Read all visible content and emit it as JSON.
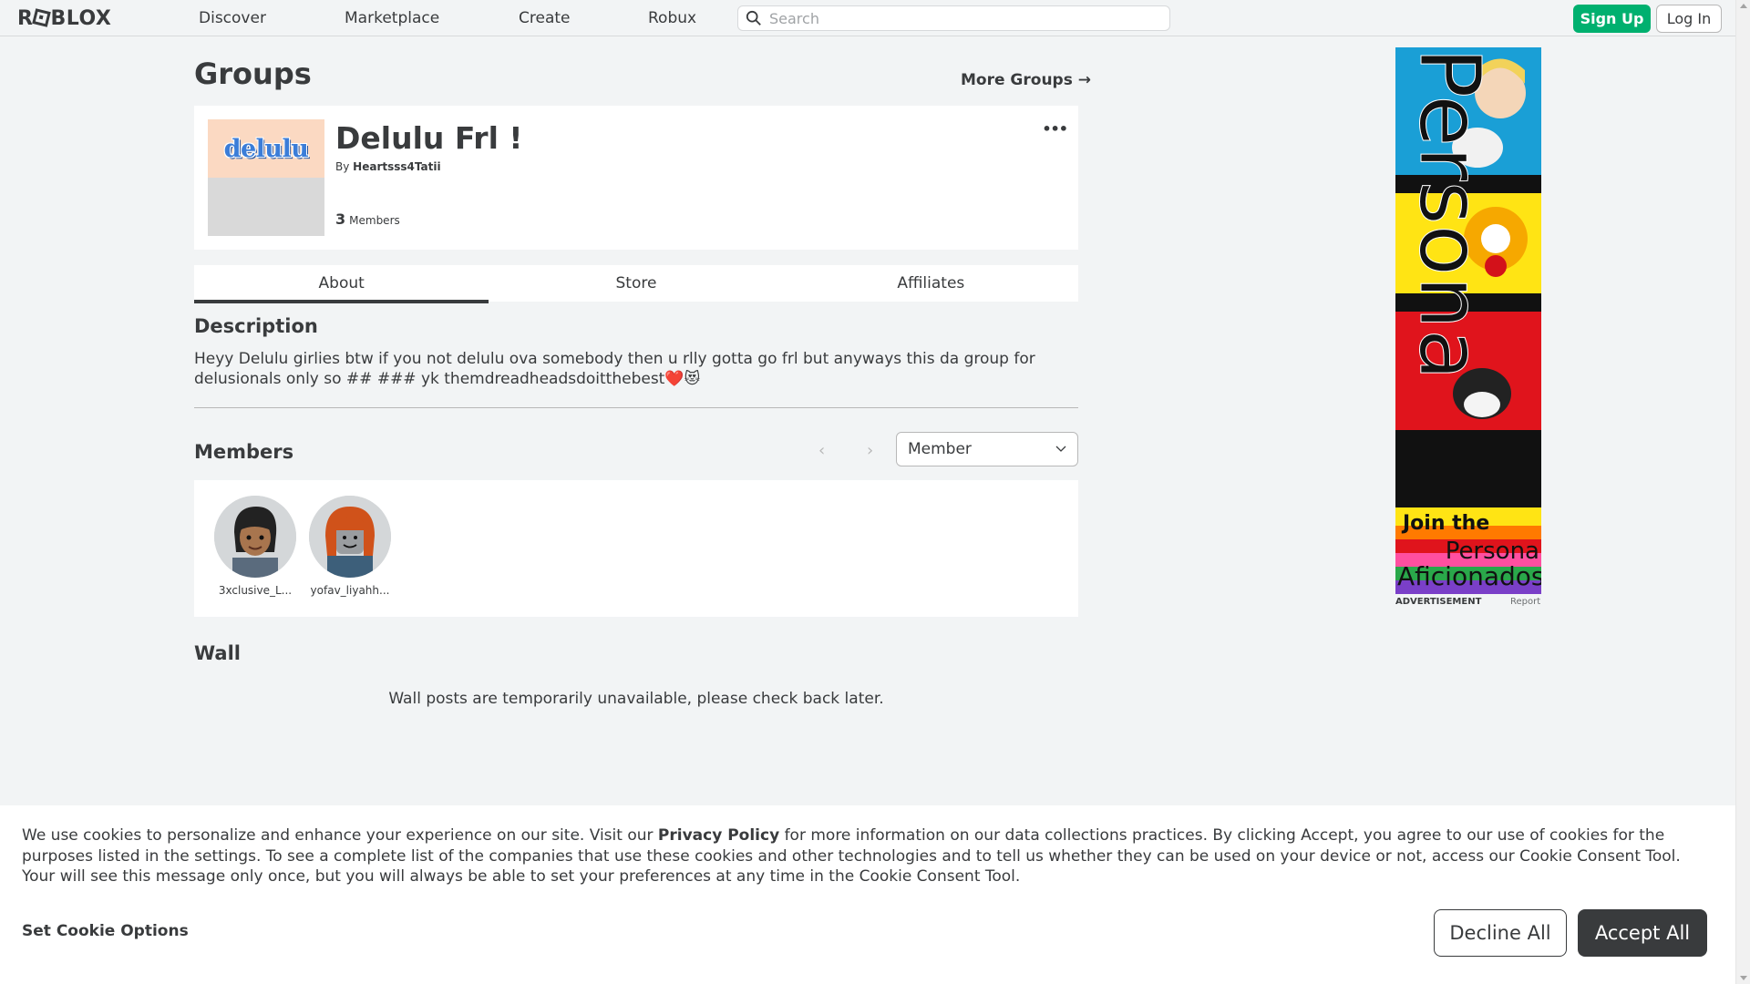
{
  "header": {
    "logo": "ROBLOX",
    "nav": [
      "Discover",
      "Marketplace",
      "Create",
      "Robux"
    ],
    "search_placeholder": "Search",
    "signup_label": "Sign Up",
    "login_label": "Log In"
  },
  "page": {
    "title": "Groups",
    "more_groups": "More Groups →"
  },
  "group": {
    "emblem_text": "delulu",
    "name": "Delulu Frl !",
    "by_prefix": "By",
    "owner": "Heartsss4Tatii",
    "member_count": "3",
    "member_label": "Members",
    "more_icon": "•••"
  },
  "tabs": [
    {
      "label": "About",
      "active": true
    },
    {
      "label": "Store",
      "active": false
    },
    {
      "label": "Affiliates",
      "active": false
    }
  ],
  "description": {
    "heading": "Description",
    "text": "Heyy Delulu girlies btw if you not delulu ova somebody then u rlly gotta go frl but anyways this da group for delusionals only so ## ### yk themdreadheadsdoitthebest❤️😻"
  },
  "members": {
    "heading": "Members",
    "prev": "‹",
    "next": "›",
    "role_filter": "Member",
    "list": [
      {
        "name": "3xclusive_L..."
      },
      {
        "name": "yofav_liyahh..."
      }
    ]
  },
  "wall": {
    "heading": "Wall",
    "message": "Wall posts are temporarily unavailable, please check back later."
  },
  "ad": {
    "label": "ADVERTISEMENT",
    "report": "Report",
    "join": "Join the",
    "persona": "Persona",
    "aficionados": "Aficionados",
    "vertical_text": "Persona"
  },
  "cookie": {
    "text_before": "We use cookies to personalize and enhance your experience on our site. Visit our ",
    "privacy_link": "Privacy Policy",
    "text_after": " for more information on our data collections practices. By clicking Accept, you agree to our use of cookies for the purposes listed in the settings. To see a complete list of the companies that use these cookies and other technologies and to tell us whether they can be used on your device or not, access our Cookie Consent Tool. Your will see this message only once, but you will always be able to set your preferences at any time in the Cookie Consent Tool.",
    "set_options": "Set Cookie Options",
    "decline": "Decline All",
    "accept": "Accept All"
  },
  "colors": {
    "signup_green": "#00b06f",
    "text_primary": "#393b3d",
    "background": "#f2f4f5"
  }
}
